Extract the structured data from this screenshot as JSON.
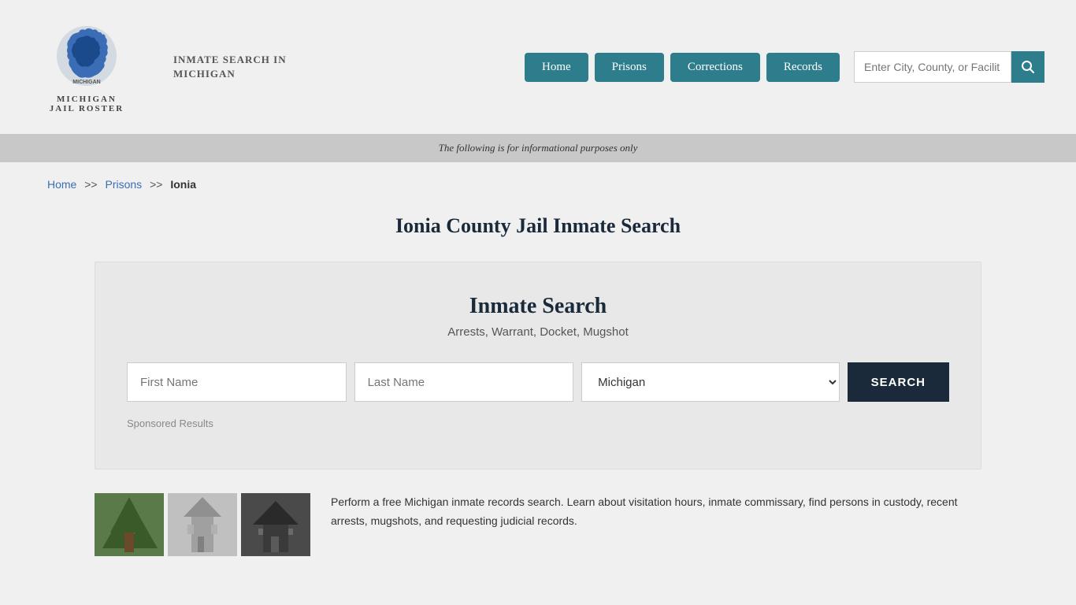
{
  "header": {
    "logo_line1": "MICHIGAN",
    "logo_line2": "JAIL ROSTER",
    "site_title": "INMATE SEARCH IN\nMICHIGAN",
    "search_placeholder": "Enter City, County, or Facilit"
  },
  "nav": {
    "home": "Home",
    "prisons": "Prisons",
    "corrections": "Corrections",
    "records": "Records"
  },
  "info_bar": {
    "message": "The following is for informational purposes only"
  },
  "breadcrumb": {
    "home": "Home",
    "prisons": "Prisons",
    "current": "Ionia"
  },
  "page": {
    "title": "Ionia County Jail Inmate Search"
  },
  "search_card": {
    "title": "Inmate Search",
    "subtitle": "Arrests, Warrant, Docket, Mugshot",
    "first_name_placeholder": "First Name",
    "last_name_placeholder": "Last Name",
    "state_default": "Michigan",
    "search_button": "SEARCH",
    "sponsored_label": "Sponsored Results"
  },
  "bottom": {
    "description": "Perform a free Michigan inmate records search. Learn about visitation hours, inmate commissary, find persons in custody, recent arrests, mugshots, and requesting judicial records."
  },
  "icons": {
    "search": "🔍",
    "chevron_down": "▾"
  }
}
